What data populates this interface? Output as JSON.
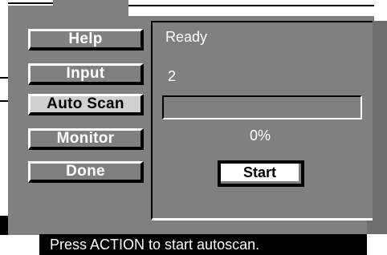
{
  "menu": {
    "items": [
      {
        "label": "Help",
        "selected": false
      },
      {
        "label": "Input",
        "selected": false
      },
      {
        "label": "Auto Scan",
        "selected": true
      },
      {
        "label": "Monitor",
        "selected": false
      },
      {
        "label": "Done",
        "selected": false
      }
    ]
  },
  "panel": {
    "status_text": "Ready",
    "count_value": "2",
    "progress_percent_label": "0%",
    "progress_fraction": 0,
    "start_label": "Start"
  },
  "statusbar": {
    "message": "Press ACTION to start autoscan."
  }
}
